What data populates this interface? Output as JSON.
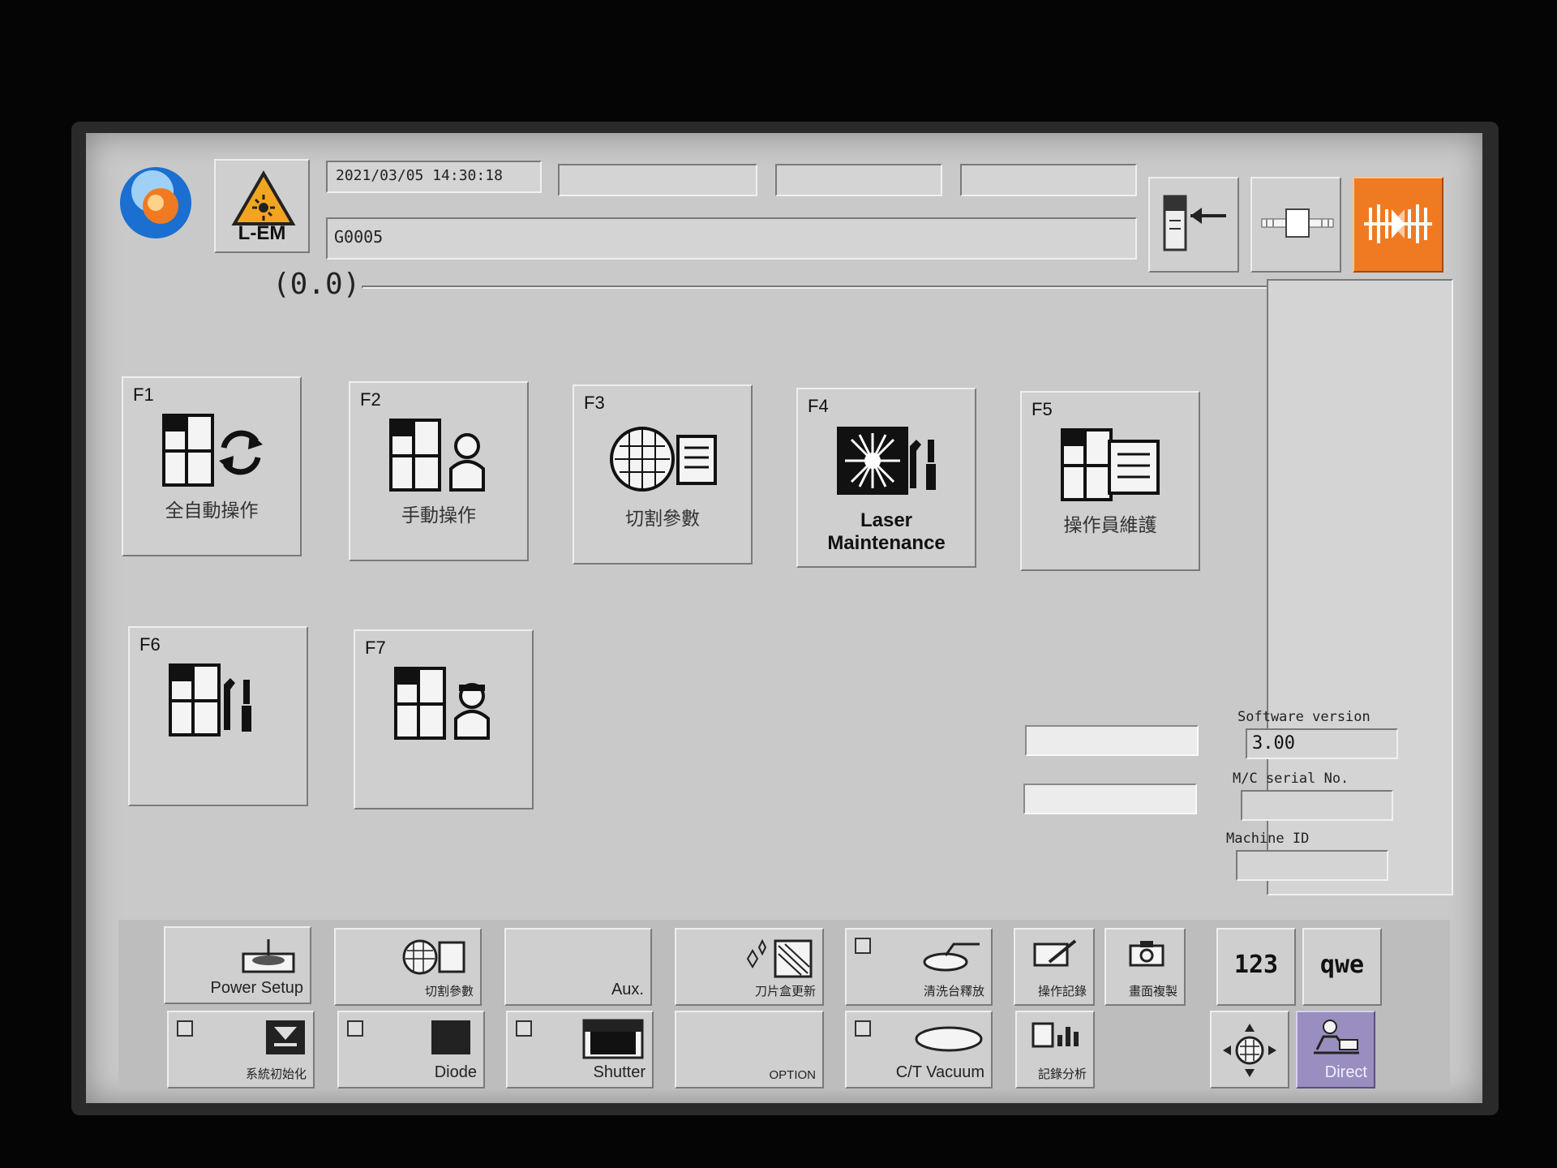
{
  "header": {
    "logo_icon": "company-logo-icon",
    "laser_label": "L-EM",
    "laser_icon": "laser-warning-icon",
    "datetime": "2021/03/05 14:30:18",
    "program": "G0005",
    "coordinates": "(0.0)",
    "right_icons": [
      "door-slide-icon",
      "chuck-icon",
      "laser-beam-icon"
    ]
  },
  "function_keys": [
    {
      "key": "F1",
      "label": "全自動操作",
      "icon": "auto-operation-icon"
    },
    {
      "key": "F2",
      "label": "手動操作",
      "icon": "manual-operation-icon"
    },
    {
      "key": "F3",
      "label": "切割參數",
      "icon": "cutting-parameter-icon"
    },
    {
      "key": "F4",
      "label": "Laser Maintenance",
      "label_line1": "Laser",
      "label_line2": "Maintenance",
      "icon": "laser-maintenance-icon"
    },
    {
      "key": "F5",
      "label": "操作員維護",
      "icon": "operator-maintenance-icon"
    },
    {
      "key": "F6",
      "label": "",
      "icon": "machine-maintenance-icon"
    },
    {
      "key": "F7",
      "label": "",
      "icon": "operator-icon"
    }
  ],
  "info": {
    "software_version_label": "Software version",
    "software_version": "3.00",
    "serial_label": "M/C serial No.",
    "serial_value": "",
    "machine_id_label": "Machine ID",
    "machine_id_value": ""
  },
  "toolbar": {
    "power_setup": "Power Setup",
    "cut_params": "切割參數",
    "aux": "Aux.",
    "blade_change": "刀片盒更新",
    "table_release": "清洗台釋放",
    "op_record": "操作記錄",
    "screen_copy": "畫面複製",
    "numeric_key": "123",
    "alpha_key": "qwe",
    "system_init": "系統初始化",
    "diode": "Diode",
    "shutter": "Shutter",
    "option": "OPTION",
    "ct_vacuum": "C/T Vacuum",
    "record_analysis": "記錄分析",
    "direct": "Direct"
  },
  "colors": {
    "screen_bg": "#c9c9c9",
    "laser_icon_bg": "#f07a22",
    "direct_bg": "#9a8ec0",
    "warning_yellow": "#f2a51f"
  }
}
